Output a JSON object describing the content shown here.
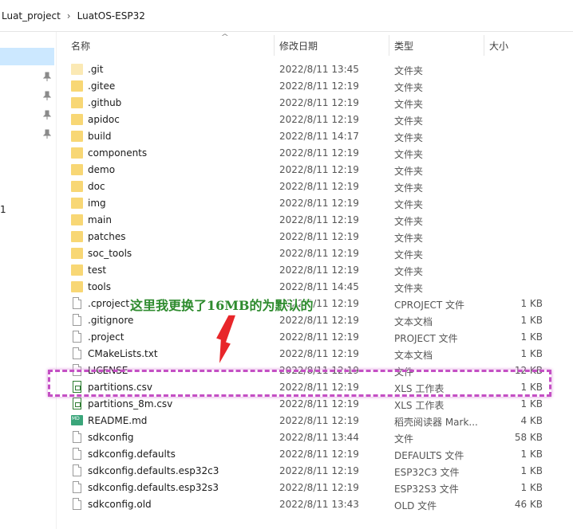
{
  "breadcrumb": {
    "items": [
      "Luat_project",
      "LuatOS-ESP32"
    ],
    "separator": "›"
  },
  "nav": {
    "partial_number": "1"
  },
  "columns": {
    "name": "名称",
    "modified": "修改日期",
    "type": "类型",
    "size": "大小"
  },
  "annotation": {
    "text": "这里我更换了16MB的为默认的"
  },
  "colors": {
    "folder": "#f8d775",
    "highlight": "#c44fc4",
    "annotation": "#2e8b2e",
    "selection": "#cce8ff"
  },
  "files": [
    {
      "name": ".git",
      "date": "2022/8/11 13:45",
      "type": "文件夹",
      "size": "",
      "icon": "folder-icon-light"
    },
    {
      "name": ".gitee",
      "date": "2022/8/11 12:19",
      "type": "文件夹",
      "size": "",
      "icon": "folder-icon"
    },
    {
      "name": ".github",
      "date": "2022/8/11 12:19",
      "type": "文件夹",
      "size": "",
      "icon": "folder-icon"
    },
    {
      "name": "apidoc",
      "date": "2022/8/11 12:19",
      "type": "文件夹",
      "size": "",
      "icon": "folder-icon"
    },
    {
      "name": "build",
      "date": "2022/8/11 14:17",
      "type": "文件夹",
      "size": "",
      "icon": "folder-icon"
    },
    {
      "name": "components",
      "date": "2022/8/11 12:19",
      "type": "文件夹",
      "size": "",
      "icon": "folder-icon"
    },
    {
      "name": "demo",
      "date": "2022/8/11 12:19",
      "type": "文件夹",
      "size": "",
      "icon": "folder-icon"
    },
    {
      "name": "doc",
      "date": "2022/8/11 12:19",
      "type": "文件夹",
      "size": "",
      "icon": "folder-icon"
    },
    {
      "name": "img",
      "date": "2022/8/11 12:19",
      "type": "文件夹",
      "size": "",
      "icon": "folder-icon"
    },
    {
      "name": "main",
      "date": "2022/8/11 12:19",
      "type": "文件夹",
      "size": "",
      "icon": "folder-icon"
    },
    {
      "name": "patches",
      "date": "2022/8/11 12:19",
      "type": "文件夹",
      "size": "",
      "icon": "folder-icon"
    },
    {
      "name": "soc_tools",
      "date": "2022/8/11 12:19",
      "type": "文件夹",
      "size": "",
      "icon": "folder-icon"
    },
    {
      "name": "test",
      "date": "2022/8/11 12:19",
      "type": "文件夹",
      "size": "",
      "icon": "folder-icon"
    },
    {
      "name": "tools",
      "date": "2022/8/11 14:45",
      "type": "文件夹",
      "size": "",
      "icon": "folder-icon"
    },
    {
      "name": ".cproject",
      "date": "2022/8/11 12:19",
      "type": "CPROJECT 文件",
      "size": "1 KB",
      "icon": "file-icon"
    },
    {
      "name": ".gitignore",
      "date": "2022/8/11 12:19",
      "type": "文本文档",
      "size": "1 KB",
      "icon": "file-icon"
    },
    {
      "name": ".project",
      "date": "2022/8/11 12:19",
      "type": "PROJECT 文件",
      "size": "1 KB",
      "icon": "file-icon"
    },
    {
      "name": "CMakeLists.txt",
      "date": "2022/8/11 12:19",
      "type": "文本文档",
      "size": "1 KB",
      "icon": "file-icon"
    },
    {
      "name": "LICENSE",
      "date": "2022/8/11 12:19",
      "type": "文件",
      "size": "12 KB",
      "icon": "file-icon"
    },
    {
      "name": "partitions.csv",
      "date": "2022/8/11 12:19",
      "type": "XLS 工作表",
      "size": "1 KB",
      "icon": "csv-icon"
    },
    {
      "name": "partitions_8m.csv",
      "date": "2022/8/11 12:19",
      "type": "XLS 工作表",
      "size": "1 KB",
      "icon": "csv-icon"
    },
    {
      "name": "README.md",
      "date": "2022/8/11 12:19",
      "type": "稻壳阅读器 Mark...",
      "size": "4 KB",
      "icon": "md-icon"
    },
    {
      "name": "sdkconfig",
      "date": "2022/8/11 13:44",
      "type": "文件",
      "size": "58 KB",
      "icon": "file-icon"
    },
    {
      "name": "sdkconfig.defaults",
      "date": "2022/8/11 12:19",
      "type": "DEFAULTS 文件",
      "size": "1 KB",
      "icon": "file-icon"
    },
    {
      "name": "sdkconfig.defaults.esp32c3",
      "date": "2022/8/11 12:19",
      "type": "ESP32C3 文件",
      "size": "1 KB",
      "icon": "file-icon"
    },
    {
      "name": "sdkconfig.defaults.esp32s3",
      "date": "2022/8/11 12:19",
      "type": "ESP32S3 文件",
      "size": "1 KB",
      "icon": "file-icon"
    },
    {
      "name": "sdkconfig.old",
      "date": "2022/8/11 13:43",
      "type": "OLD 文件",
      "size": "46 KB",
      "icon": "file-icon"
    }
  ]
}
